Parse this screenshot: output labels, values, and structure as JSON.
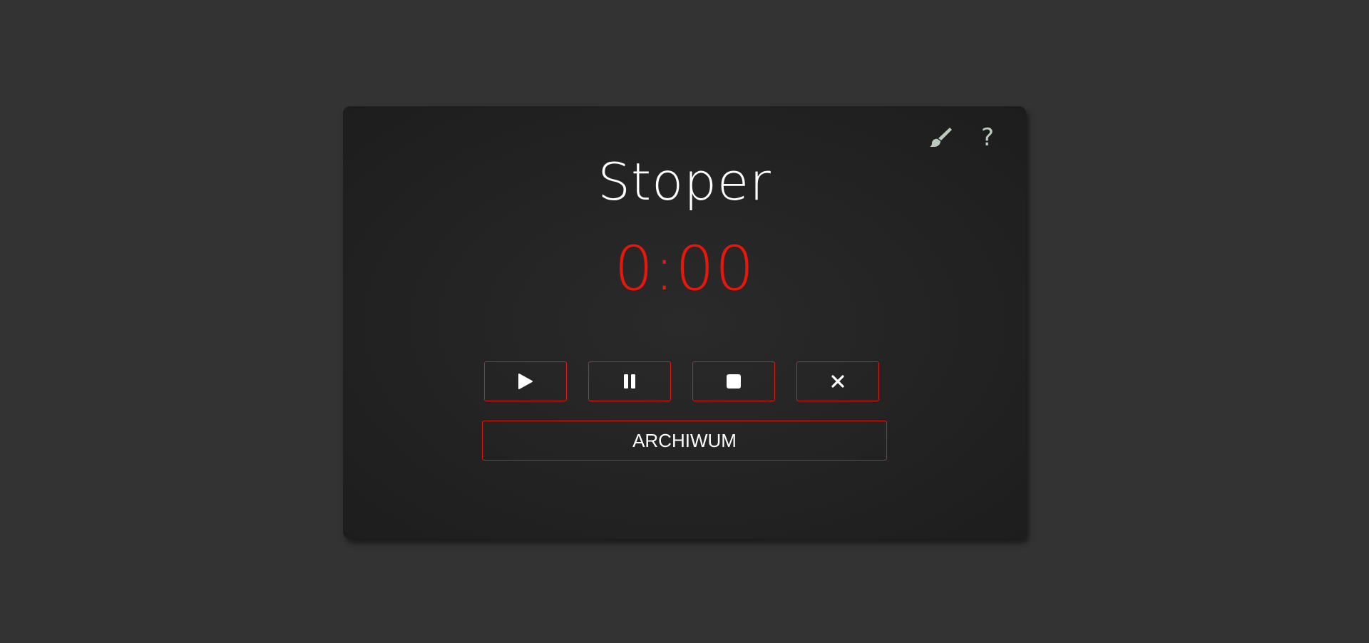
{
  "app": {
    "title": "Stoper",
    "time": "0:00"
  },
  "top_icons": {
    "brush_icon": "paint-brush-icon",
    "help_label": "?"
  },
  "controls": [
    {
      "name": "play",
      "icon": "play-icon"
    },
    {
      "name": "pause",
      "icon": "pause-icon"
    },
    {
      "name": "stop",
      "icon": "stop-icon"
    },
    {
      "name": "reset",
      "icon": "close-icon"
    }
  ],
  "archive": {
    "label": "ARCHIWUM"
  },
  "colors": {
    "background": "#333333",
    "card": "#1f1f1f",
    "accent_red": "#e8170c",
    "icon_sage": "#b9cbbd",
    "text": "#ffffff"
  }
}
